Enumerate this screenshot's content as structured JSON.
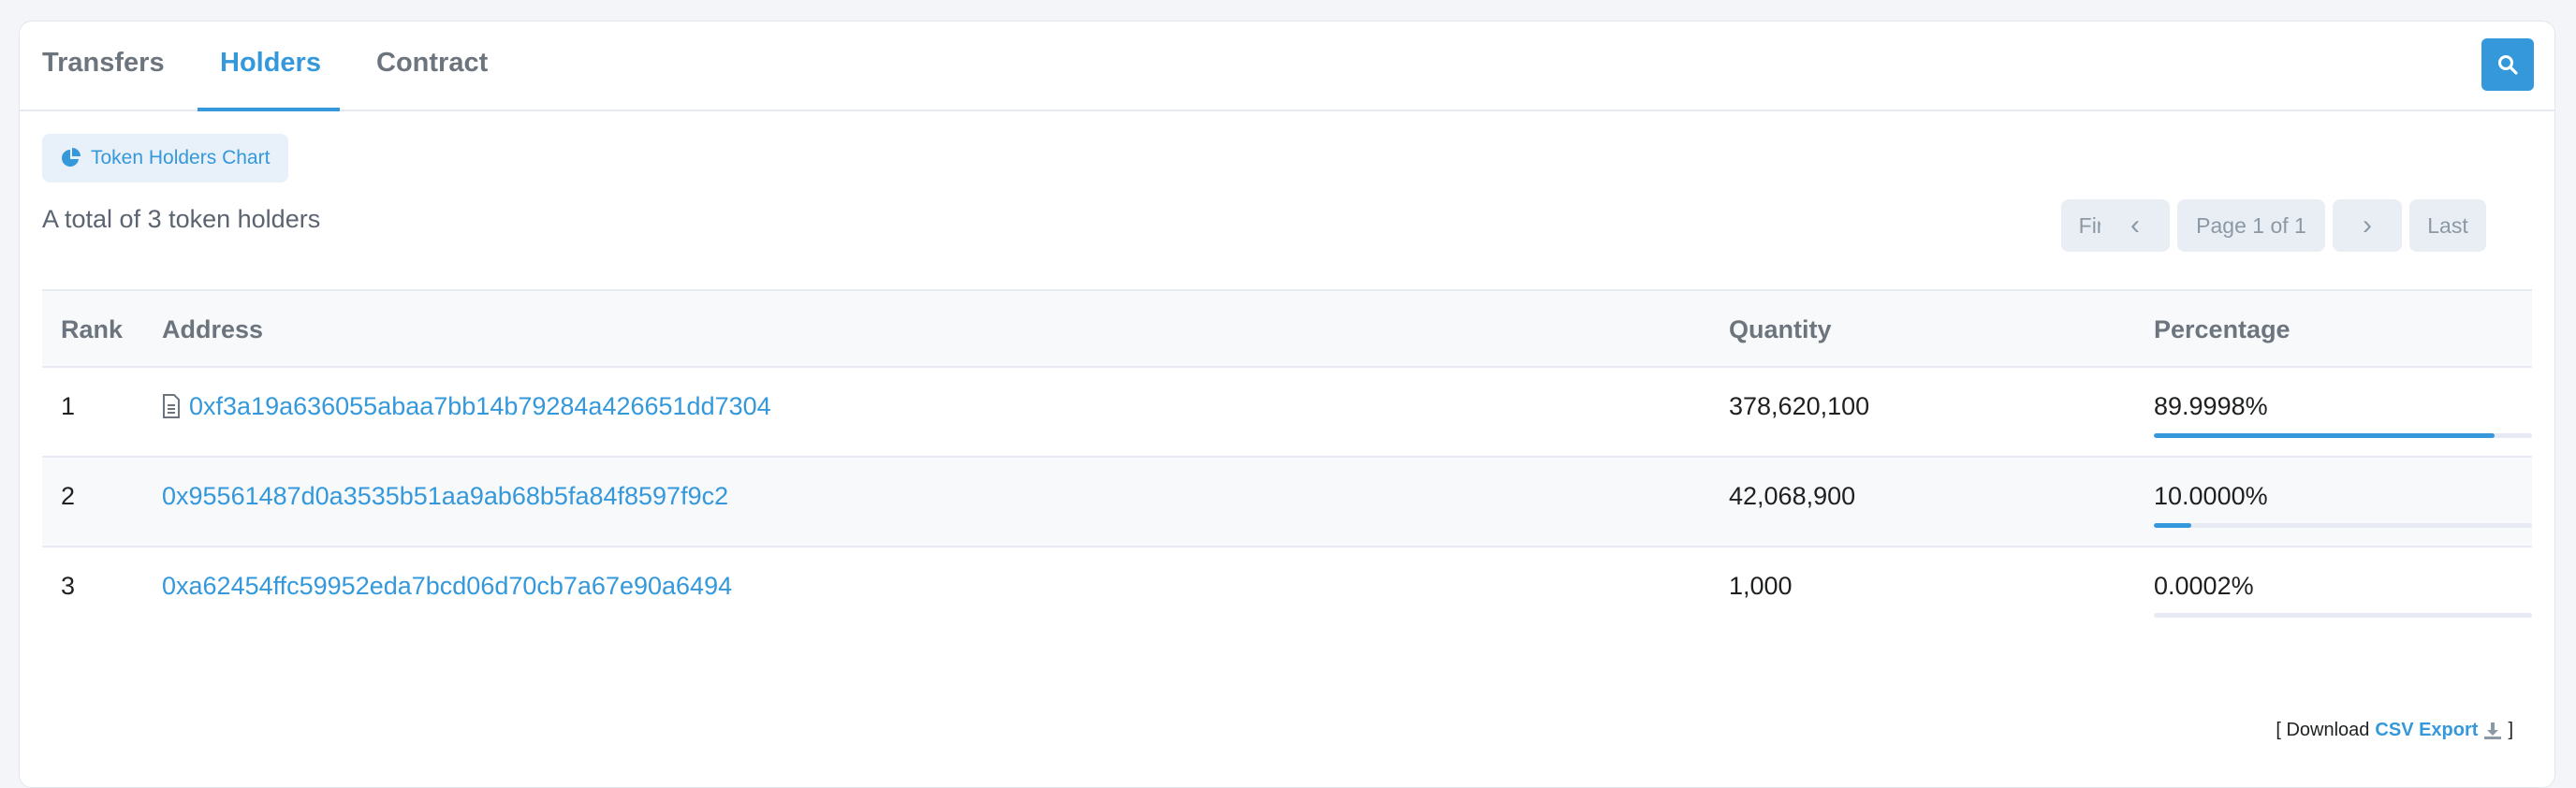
{
  "tabs": [
    {
      "label": "Transfers",
      "active": false
    },
    {
      "label": "Holders",
      "active": true
    },
    {
      "label": "Contract",
      "active": false
    }
  ],
  "actions": {
    "search_icon": "search-icon",
    "chart_button_label": "Token Holders Chart",
    "chart_icon": "pie-chart-icon"
  },
  "summary": {
    "total_text": "A total of 3 token holders"
  },
  "pagination": {
    "first": "First",
    "prev": "‹",
    "page_text": "Page 1 of 1",
    "next": "›",
    "last": "Last"
  },
  "table": {
    "columns": [
      "Rank",
      "Address",
      "Quantity",
      "Percentage"
    ],
    "rows": [
      {
        "rank": "1",
        "address": "0xf3a19a636055abaa7bb14b79284a426651dd7304",
        "is_contract": true,
        "quantity": "378,620,100",
        "percentage": "89.9998%",
        "share": 0.899998
      },
      {
        "rank": "2",
        "address": "0x95561487d0a3535b51aa9ab68b5fa84f8597f9c2",
        "is_contract": false,
        "quantity": "42,068,900",
        "percentage": "10.0000%",
        "share": 0.1
      },
      {
        "rank": "3",
        "address": "0xa62454ffc59952eda7bcd06d70cb7a67e90a6494",
        "is_contract": false,
        "quantity": "1,000",
        "percentage": "0.0002%",
        "share": 2e-06
      }
    ]
  },
  "footer": {
    "prefix": "[ Download",
    "link_label": "CSV Export",
    "suffix": "]"
  },
  "colors": {
    "accent": "#3498db",
    "muted": "#6c757e"
  }
}
